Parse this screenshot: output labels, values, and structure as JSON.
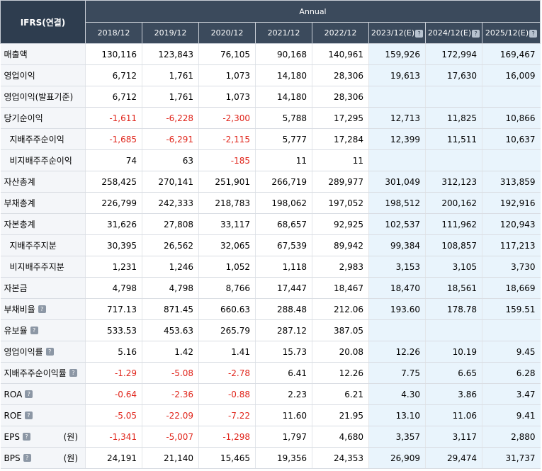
{
  "header": {
    "corner_label": "IFRS(연결)",
    "group_label": "Annual",
    "periods": [
      "2018/12",
      "2019/12",
      "2020/12",
      "2021/12",
      "2022/12",
      "2023/12(E)",
      "2024/12(E)",
      "2025/12(E)"
    ],
    "period_help": [
      false,
      false,
      false,
      false,
      false,
      true,
      true,
      true
    ]
  },
  "help_icon_glyph": "?",
  "colors": {
    "header_bg": "#3b4a5c",
    "negative": "#e0241a",
    "estimate_bg": "#e9f4fc"
  },
  "rows": [
    {
      "label": "매출액",
      "indent": false,
      "help": false,
      "unit": "",
      "values": [
        "130,116",
        "123,843",
        "76,105",
        "90,168",
        "140,961",
        "159,926",
        "172,994",
        "169,467"
      ]
    },
    {
      "label": "영업이익",
      "indent": false,
      "help": false,
      "unit": "",
      "values": [
        "6,712",
        "1,761",
        "1,073",
        "14,180",
        "28,306",
        "19,613",
        "17,630",
        "16,009"
      ]
    },
    {
      "label": "영업이익(발표기준)",
      "indent": false,
      "help": false,
      "unit": "",
      "values": [
        "6,712",
        "1,761",
        "1,073",
        "14,180",
        "28,306",
        "",
        "",
        ""
      ]
    },
    {
      "label": "당기순이익",
      "indent": false,
      "help": false,
      "unit": "",
      "values": [
        "-1,611",
        "-6,228",
        "-2,300",
        "5,788",
        "17,295",
        "12,713",
        "11,825",
        "10,866"
      ]
    },
    {
      "label": "지배주주순이익",
      "indent": true,
      "help": false,
      "unit": "",
      "values": [
        "-1,685",
        "-6,291",
        "-2,115",
        "5,777",
        "17,284",
        "12,399",
        "11,511",
        "10,637"
      ]
    },
    {
      "label": "비지배주주순이익",
      "indent": true,
      "help": false,
      "unit": "",
      "values": [
        "74",
        "63",
        "-185",
        "11",
        "11",
        "",
        "",
        ""
      ]
    },
    {
      "label": "자산총계",
      "indent": false,
      "help": false,
      "unit": "",
      "values": [
        "258,425",
        "270,141",
        "251,901",
        "266,719",
        "289,977",
        "301,049",
        "312,123",
        "313,859"
      ]
    },
    {
      "label": "부채총계",
      "indent": false,
      "help": false,
      "unit": "",
      "values": [
        "226,799",
        "242,333",
        "218,783",
        "198,062",
        "197,052",
        "198,512",
        "200,162",
        "192,916"
      ]
    },
    {
      "label": "자본총계",
      "indent": false,
      "help": false,
      "unit": "",
      "values": [
        "31,626",
        "27,808",
        "33,117",
        "68,657",
        "92,925",
        "102,537",
        "111,962",
        "120,943"
      ]
    },
    {
      "label": "지배주주지분",
      "indent": true,
      "help": false,
      "unit": "",
      "values": [
        "30,395",
        "26,562",
        "32,065",
        "67,539",
        "89,942",
        "99,384",
        "108,857",
        "117,213"
      ]
    },
    {
      "label": "비지배주주지분",
      "indent": true,
      "help": false,
      "unit": "",
      "values": [
        "1,231",
        "1,246",
        "1,052",
        "1,118",
        "2,983",
        "3,153",
        "3,105",
        "3,730"
      ]
    },
    {
      "label": "자본금",
      "indent": false,
      "help": false,
      "unit": "",
      "values": [
        "4,798",
        "4,798",
        "8,766",
        "17,447",
        "18,467",
        "18,470",
        "18,561",
        "18,669"
      ]
    },
    {
      "label": "부채비율",
      "indent": false,
      "help": true,
      "unit": "",
      "values": [
        "717.13",
        "871.45",
        "660.63",
        "288.48",
        "212.06",
        "193.60",
        "178.78",
        "159.51"
      ]
    },
    {
      "label": "유보율",
      "indent": false,
      "help": true,
      "unit": "",
      "values": [
        "533.53",
        "453.63",
        "265.79",
        "287.12",
        "387.05",
        "",
        "",
        ""
      ]
    },
    {
      "label": "영업이익률",
      "indent": false,
      "help": true,
      "unit": "",
      "values": [
        "5.16",
        "1.42",
        "1.41",
        "15.73",
        "20.08",
        "12.26",
        "10.19",
        "9.45"
      ]
    },
    {
      "label": "지배주주순이익률",
      "indent": false,
      "help": true,
      "unit": "",
      "values": [
        "-1.29",
        "-5.08",
        "-2.78",
        "6.41",
        "12.26",
        "7.75",
        "6.65",
        "6.28"
      ]
    },
    {
      "label": "ROA",
      "indent": false,
      "help": true,
      "unit": "",
      "values": [
        "-0.64",
        "-2.36",
        "-0.88",
        "2.23",
        "6.21",
        "4.30",
        "3.86",
        "3.47"
      ]
    },
    {
      "label": "ROE",
      "indent": false,
      "help": true,
      "unit": "",
      "values": [
        "-5.05",
        "-22.09",
        "-7.22",
        "11.60",
        "21.95",
        "13.10",
        "11.06",
        "9.41"
      ]
    },
    {
      "label": "EPS",
      "indent": false,
      "help": true,
      "unit": "(원)",
      "values": [
        "-1,341",
        "-5,007",
        "-1,298",
        "1,797",
        "4,680",
        "3,357",
        "3,117",
        "2,880"
      ]
    },
    {
      "label": "BPS",
      "indent": false,
      "help": true,
      "unit": "(원)",
      "values": [
        "24,191",
        "21,140",
        "15,465",
        "19,356",
        "24,353",
        "26,909",
        "29,474",
        "31,737"
      ]
    }
  ]
}
